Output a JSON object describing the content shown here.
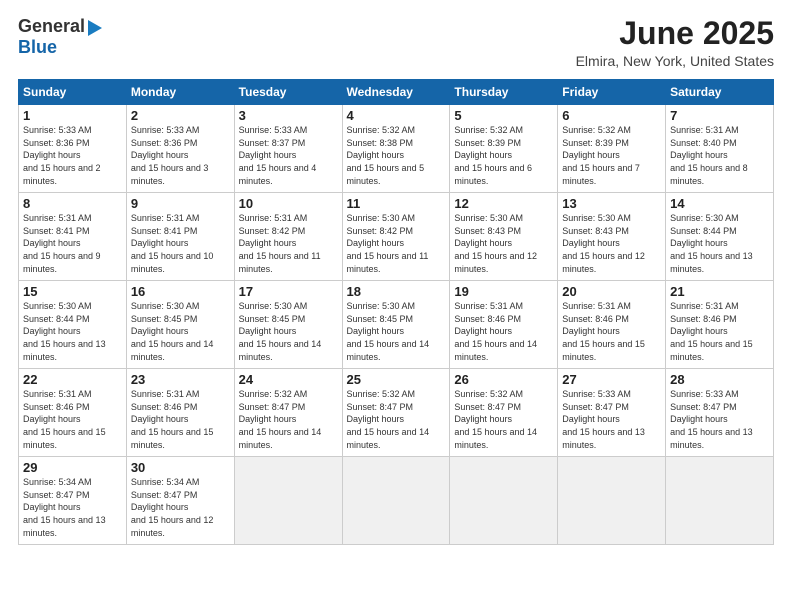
{
  "header": {
    "logo_general": "General",
    "logo_blue": "Blue",
    "month_title": "June 2025",
    "location": "Elmira, New York, United States"
  },
  "weekdays": [
    "Sunday",
    "Monday",
    "Tuesday",
    "Wednesday",
    "Thursday",
    "Friday",
    "Saturday"
  ],
  "weeks": [
    [
      {
        "day": "1",
        "sunrise": "5:33 AM",
        "sunset": "8:36 PM",
        "daylight": "15 hours and 2 minutes."
      },
      {
        "day": "2",
        "sunrise": "5:33 AM",
        "sunset": "8:36 PM",
        "daylight": "15 hours and 3 minutes."
      },
      {
        "day": "3",
        "sunrise": "5:33 AM",
        "sunset": "8:37 PM",
        "daylight": "15 hours and 4 minutes."
      },
      {
        "day": "4",
        "sunrise": "5:32 AM",
        "sunset": "8:38 PM",
        "daylight": "15 hours and 5 minutes."
      },
      {
        "day": "5",
        "sunrise": "5:32 AM",
        "sunset": "8:39 PM",
        "daylight": "15 hours and 6 minutes."
      },
      {
        "day": "6",
        "sunrise": "5:32 AM",
        "sunset": "8:39 PM",
        "daylight": "15 hours and 7 minutes."
      },
      {
        "day": "7",
        "sunrise": "5:31 AM",
        "sunset": "8:40 PM",
        "daylight": "15 hours and 8 minutes."
      }
    ],
    [
      {
        "day": "8",
        "sunrise": "5:31 AM",
        "sunset": "8:41 PM",
        "daylight": "15 hours and 9 minutes."
      },
      {
        "day": "9",
        "sunrise": "5:31 AM",
        "sunset": "8:41 PM",
        "daylight": "15 hours and 10 minutes."
      },
      {
        "day": "10",
        "sunrise": "5:31 AM",
        "sunset": "8:42 PM",
        "daylight": "15 hours and 11 minutes."
      },
      {
        "day": "11",
        "sunrise": "5:30 AM",
        "sunset": "8:42 PM",
        "daylight": "15 hours and 11 minutes."
      },
      {
        "day": "12",
        "sunrise": "5:30 AM",
        "sunset": "8:43 PM",
        "daylight": "15 hours and 12 minutes."
      },
      {
        "day": "13",
        "sunrise": "5:30 AM",
        "sunset": "8:43 PM",
        "daylight": "15 hours and 12 minutes."
      },
      {
        "day": "14",
        "sunrise": "5:30 AM",
        "sunset": "8:44 PM",
        "daylight": "15 hours and 13 minutes."
      }
    ],
    [
      {
        "day": "15",
        "sunrise": "5:30 AM",
        "sunset": "8:44 PM",
        "daylight": "15 hours and 13 minutes."
      },
      {
        "day": "16",
        "sunrise": "5:30 AM",
        "sunset": "8:45 PM",
        "daylight": "15 hours and 14 minutes."
      },
      {
        "day": "17",
        "sunrise": "5:30 AM",
        "sunset": "8:45 PM",
        "daylight": "15 hours and 14 minutes."
      },
      {
        "day": "18",
        "sunrise": "5:30 AM",
        "sunset": "8:45 PM",
        "daylight": "15 hours and 14 minutes."
      },
      {
        "day": "19",
        "sunrise": "5:31 AM",
        "sunset": "8:46 PM",
        "daylight": "15 hours and 14 minutes."
      },
      {
        "day": "20",
        "sunrise": "5:31 AM",
        "sunset": "8:46 PM",
        "daylight": "15 hours and 15 minutes."
      },
      {
        "day": "21",
        "sunrise": "5:31 AM",
        "sunset": "8:46 PM",
        "daylight": "15 hours and 15 minutes."
      }
    ],
    [
      {
        "day": "22",
        "sunrise": "5:31 AM",
        "sunset": "8:46 PM",
        "daylight": "15 hours and 15 minutes."
      },
      {
        "day": "23",
        "sunrise": "5:31 AM",
        "sunset": "8:46 PM",
        "daylight": "15 hours and 15 minutes."
      },
      {
        "day": "24",
        "sunrise": "5:32 AM",
        "sunset": "8:47 PM",
        "daylight": "15 hours and 14 minutes."
      },
      {
        "day": "25",
        "sunrise": "5:32 AM",
        "sunset": "8:47 PM",
        "daylight": "15 hours and 14 minutes."
      },
      {
        "day": "26",
        "sunrise": "5:32 AM",
        "sunset": "8:47 PM",
        "daylight": "15 hours and 14 minutes."
      },
      {
        "day": "27",
        "sunrise": "5:33 AM",
        "sunset": "8:47 PM",
        "daylight": "15 hours and 13 minutes."
      },
      {
        "day": "28",
        "sunrise": "5:33 AM",
        "sunset": "8:47 PM",
        "daylight": "15 hours and 13 minutes."
      }
    ],
    [
      {
        "day": "29",
        "sunrise": "5:34 AM",
        "sunset": "8:47 PM",
        "daylight": "15 hours and 13 minutes."
      },
      {
        "day": "30",
        "sunrise": "5:34 AM",
        "sunset": "8:47 PM",
        "daylight": "15 hours and 12 minutes."
      },
      null,
      null,
      null,
      null,
      null
    ]
  ]
}
